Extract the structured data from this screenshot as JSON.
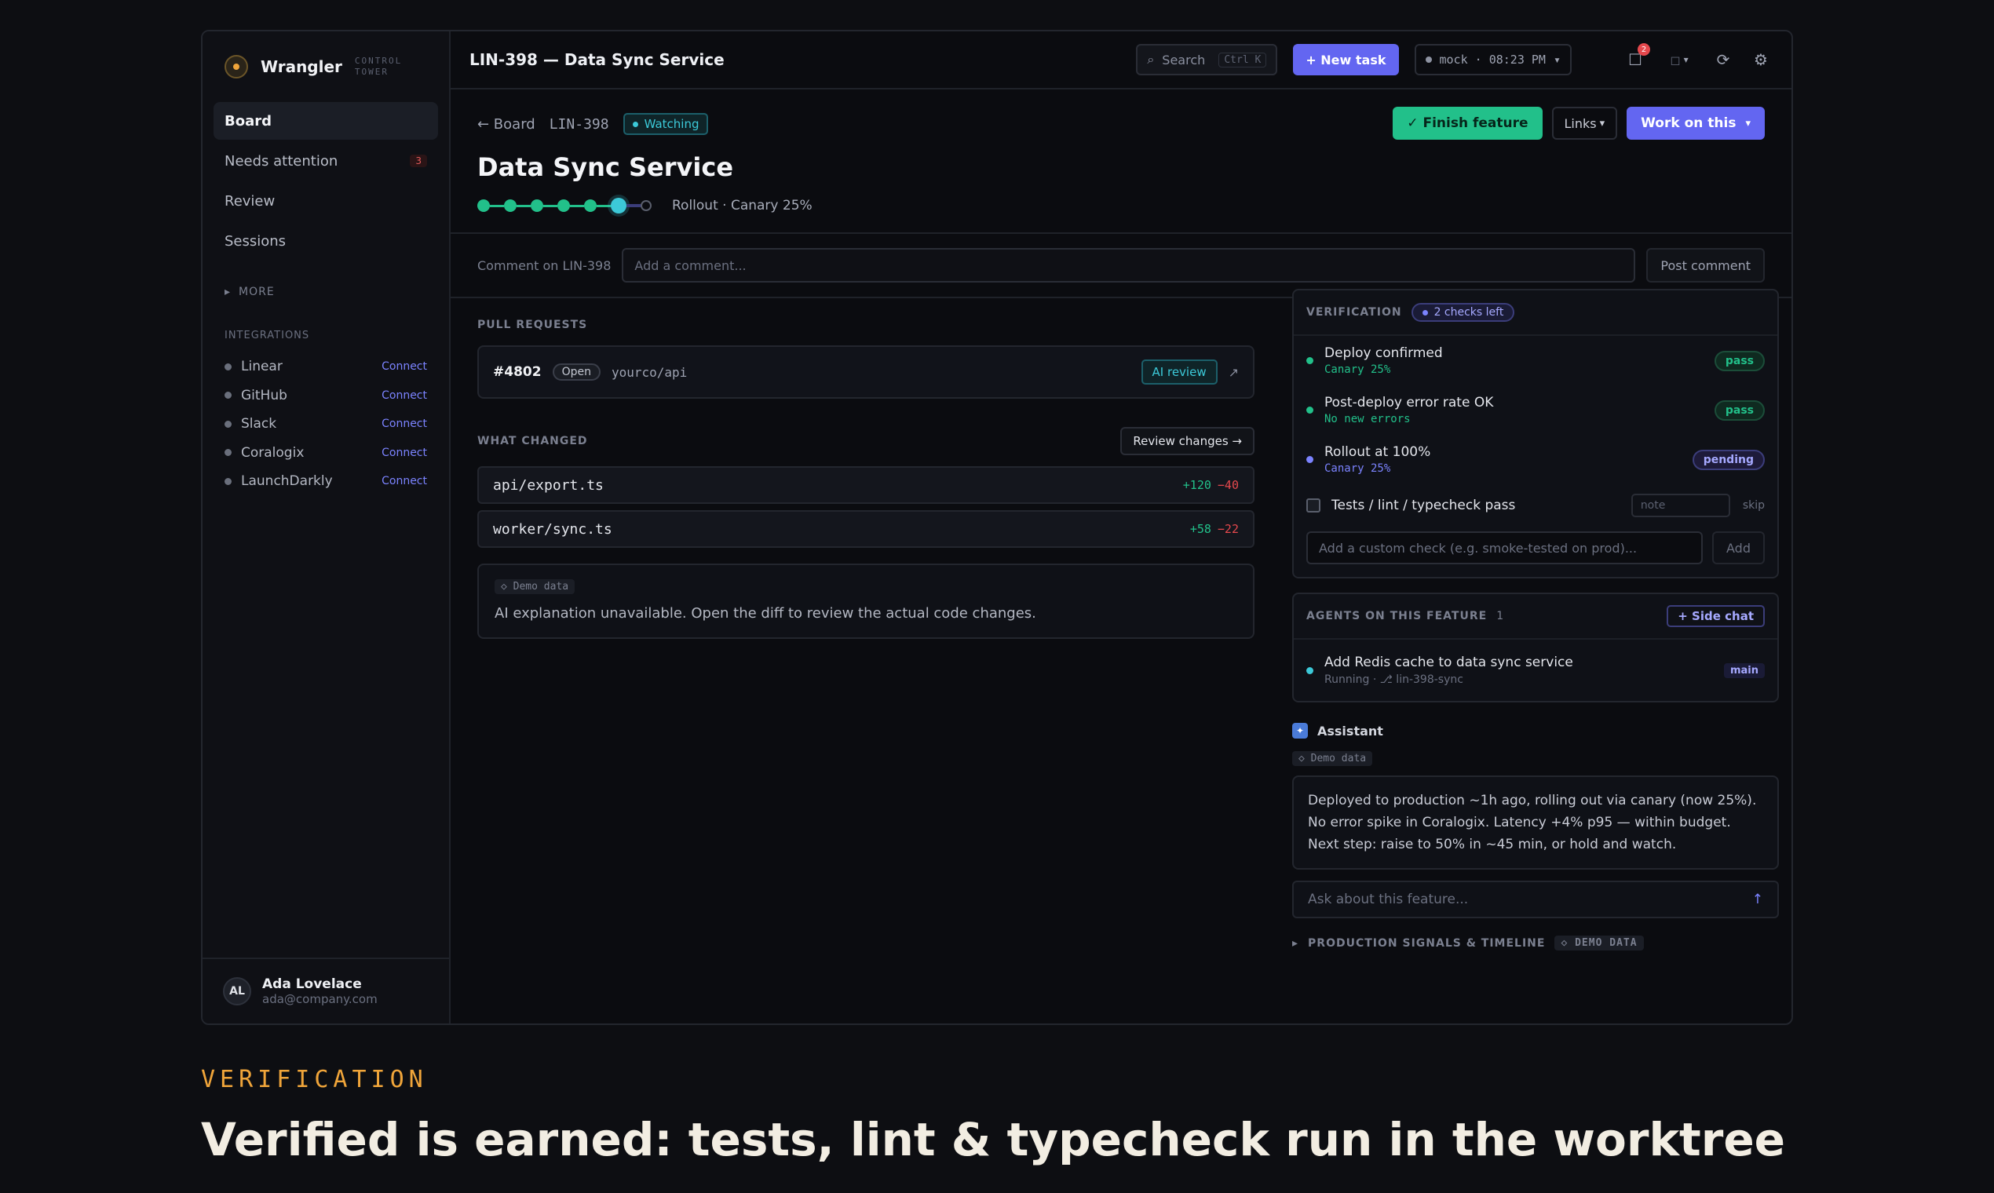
{
  "brand": {
    "name": "Wrangler",
    "sub": "CONTROL TOWER"
  },
  "nav": [
    {
      "label": "Board",
      "active": true
    },
    {
      "label": "Needs attention",
      "count": "3"
    },
    {
      "label": "Review"
    },
    {
      "label": "Sessions"
    }
  ],
  "more_label": "MORE",
  "integrations_label": "INTEGRATIONS",
  "integrations": [
    {
      "name": "Linear",
      "action": "Connect"
    },
    {
      "name": "GitHub",
      "action": "Connect"
    },
    {
      "name": "Slack",
      "action": "Connect"
    },
    {
      "name": "Coralogix",
      "action": "Connect"
    },
    {
      "name": "LaunchDarkly",
      "action": "Connect"
    }
  ],
  "user": {
    "initials": "AL",
    "name": "Ada Lovelace",
    "email": "ada@company.com"
  },
  "topbar": {
    "title": "LIN-398 — Data Sync Service",
    "search_label": "Search",
    "search_shortcut": "Ctrl K",
    "new_task": "+ New task",
    "env": "mock · 08:23 PM",
    "notif_count": "2"
  },
  "header": {
    "back": "← Board",
    "ticket": "LIN-398",
    "status": "Watching",
    "title": "Data Sync Service",
    "stage": "Rollout · Canary 25%",
    "finish": "✓ Finish feature",
    "links": "Links",
    "work": "Work on this"
  },
  "comment": {
    "label": "Comment on LIN-398",
    "placeholder": "Add a comment...",
    "button": "Post comment"
  },
  "pull_requests": {
    "label": "PULL REQUESTS",
    "number": "#4802",
    "state": "Open",
    "repo": "yourco/api",
    "ai_review": "AI review"
  },
  "changes": {
    "label": "WHAT CHANGED",
    "review_button": "Review changes →",
    "files": [
      {
        "path": "api/export.ts",
        "added": "+120",
        "removed": "−40"
      },
      {
        "path": "worker/sync.ts",
        "added": "+58",
        "removed": "−22"
      }
    ],
    "demo_tag": "◇ Demo data",
    "explanation": "AI explanation unavailable. Open the diff to review the actual code changes."
  },
  "verification": {
    "label": "VERIFICATION",
    "checks_left": "2 checks left",
    "checks": [
      {
        "title": "Deploy confirmed",
        "sub": "Canary 25%",
        "status": "pass"
      },
      {
        "title": "Post-deploy error rate OK",
        "sub": "No new errors",
        "status": "pass"
      },
      {
        "title": "Rollout at 100%",
        "sub": "Canary 25%",
        "status": "pending"
      }
    ],
    "manual_check": "Tests / lint / typecheck pass",
    "note_placeholder": "note",
    "skip": "skip",
    "custom_placeholder": "Add a custom check (e.g. smoke-tested on prod)...",
    "add": "Add"
  },
  "agents": {
    "label": "AGENTS ON THIS FEATURE",
    "count": "1",
    "side_chat": "+ Side chat",
    "items": [
      {
        "title": "Add Redis cache to data sync service",
        "status": "Running · ⎇ lin-398-sync",
        "branch": "main"
      }
    ]
  },
  "assistant": {
    "label": "Assistant",
    "demo_tag": "◇ Demo data",
    "message": "Deployed to production ~1h ago, rolling out via canary (now 25%). No error spike in Coralogix. Latency +4% p95 — within budget. Next step: raise to 50% in ~45 min, or hold and watch.",
    "ask_placeholder": "Ask about this feature...",
    "send": "↑"
  },
  "signals": {
    "label": "PRODUCTION SIGNALS & TIMELINE",
    "tag": "◇ DEMO DATA"
  },
  "caption": {
    "tag": "VERIFICATION",
    "headline": "Verified is earned: tests, lint & typecheck run in the worktree"
  },
  "colors": {
    "accent": "#6366f1",
    "success": "#22c08a",
    "teal": "#3cc9d8",
    "caption": "#f0a53a"
  }
}
